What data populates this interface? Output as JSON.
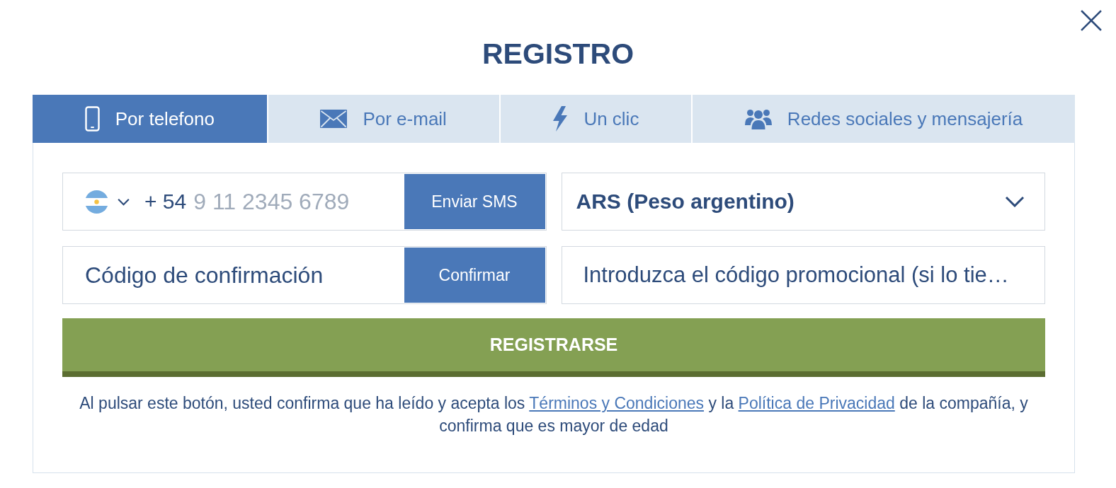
{
  "title": "REGISTRO",
  "tabs": [
    {
      "kind": "phone",
      "label": "Por telefono",
      "selected": true
    },
    {
      "kind": "email",
      "label": "Por e-mail",
      "selected": false
    },
    {
      "kind": "click",
      "label": "Un clic",
      "selected": false
    },
    {
      "kind": "social",
      "label": "Redes sociales y mensajería",
      "selected": false
    }
  ],
  "phone": {
    "dial_code": "+ 54",
    "placeholder": "9 11 2345 6789",
    "button": "Enviar SMS"
  },
  "currency": {
    "value": "ARS (Peso argentino)"
  },
  "confirmation_code": {
    "placeholder": "Código de confirmación",
    "button": "Confirmar"
  },
  "promo_code": {
    "placeholder": "Introduzca el código promocional (si lo tie…"
  },
  "submit_button": "REGISTRARSE",
  "notice": [
    {
      "kind": "text",
      "text": "Al pulsar este botón, usted confirma que ha leído y acepta los"
    },
    {
      "kind": "link",
      "text": "Términos y Condiciones"
    },
    {
      "kind": "text",
      "text": "y la"
    },
    {
      "kind": "link",
      "text": "Política de Privacidad"
    },
    {
      "kind": "text",
      "text": "de la compañía, y confirma que es mayor de edad"
    }
  ]
}
